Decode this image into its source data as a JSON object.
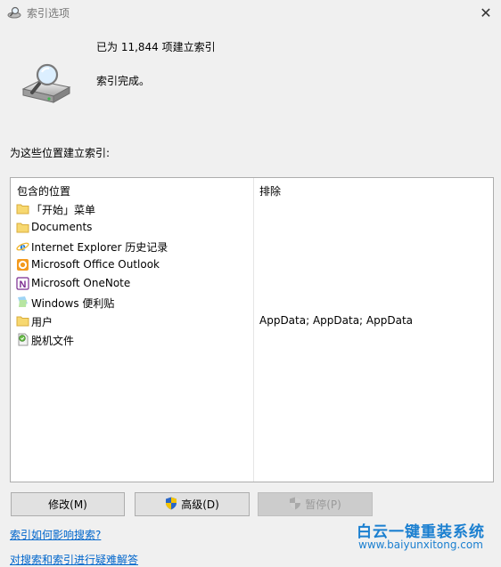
{
  "window": {
    "title": "索引选项",
    "close_symbol": "✕"
  },
  "status": {
    "count_text": "已为 11,844 项建立索引",
    "message": "索引完成。"
  },
  "section_label": "为这些位置建立索引:",
  "table": {
    "headers": {
      "included": "包含的位置",
      "excluded": "排除"
    },
    "rows": [
      {
        "icon": "folder-icon",
        "name": "「开始」菜单",
        "exclude": ""
      },
      {
        "icon": "folder-icon",
        "name": "Documents",
        "exclude": ""
      },
      {
        "icon": "internet-explorer-icon",
        "name": "Internet Explorer 历史记录",
        "exclude": ""
      },
      {
        "icon": "outlook-icon",
        "name": "Microsoft Office Outlook",
        "exclude": ""
      },
      {
        "icon": "onenote-icon",
        "name": "Microsoft OneNote",
        "exclude": ""
      },
      {
        "icon": "sticky-notes-icon",
        "name": "Windows 便利贴",
        "exclude": ""
      },
      {
        "icon": "folder-icon",
        "name": "用户",
        "exclude": "AppData; AppData; AppData"
      },
      {
        "icon": "offline-files-icon",
        "name": "脱机文件",
        "exclude": ""
      }
    ]
  },
  "buttons": {
    "modify": "修改(M)",
    "advanced": "高级(D)",
    "pause": "暂停(P)"
  },
  "links": {
    "search_effect": "索引如何影响搜索?",
    "troubleshoot": "对搜索和索引进行疑难解答"
  },
  "watermark": {
    "brand": "白云一键重装系统",
    "url": "www.baiyunxitong.com"
  },
  "colors": {
    "link": "#0066cc",
    "folder": "#f7d870",
    "watermark": "#1a7fd0"
  }
}
